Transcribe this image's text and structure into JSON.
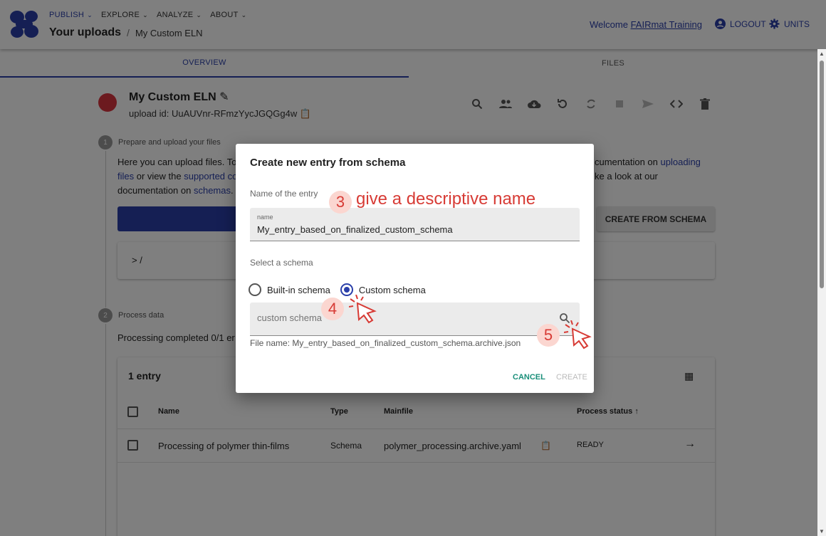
{
  "header": {
    "menus": [
      "PUBLISH",
      "EXPLORE",
      "ANALYZE",
      "ABOUT"
    ],
    "breadcrumb_root": "Your uploads",
    "breadcrumb_sep": "/",
    "breadcrumb_current": "My Custom ELN",
    "welcome_prefix": "Welcome ",
    "welcome_user": "FAIRmat Training",
    "logout": "LOGOUT",
    "units": "UNITS"
  },
  "tabs": {
    "overview": "OVERVIEW",
    "files": "FILES"
  },
  "upload": {
    "title": "My Custom ELN",
    "id_label": "upload id: UuAUVnr-RFmzYycJGQGg4w"
  },
  "step1": {
    "num": "1",
    "title": "Prepare and upload your files",
    "text_a": "Here you can upload files. Top",
    "text_b": "cumentation on ",
    "link_uploading": "uploading",
    "link_files": "files",
    "text_c": " or view the ",
    "link_supported": "supported co",
    "text_d": "ke a look at our",
    "text_e": "documentation on ",
    "link_schemas": "schemas",
    "text_f": ".",
    "create_from_schema": "CREATE FROM SCHEMA",
    "path": "> /"
  },
  "step2": {
    "num": "2",
    "title": "Process data",
    "processing": "Processing completed  0/1 er"
  },
  "table": {
    "title": "1 entry",
    "columns": [
      "Name",
      "Type",
      "Mainfile",
      "Process status ↑"
    ],
    "rows": [
      {
        "name": "Processing of polymer thin-films",
        "type": "Schema",
        "mainfile": "polymer_processing.archive.yaml",
        "status": "READY"
      }
    ]
  },
  "dialog": {
    "title": "Create new entry from schema",
    "name_section": "Name of the entry",
    "name_label": "name",
    "name_value": "My_entry_based_on_finalized_custom_schema",
    "schema_section": "Select a schema",
    "builtin": "Built-in schema",
    "custom": "Custom schema",
    "schema_placeholder": "custom schema",
    "file_name": "File name: My_entry_based_on_finalized_custom_schema.archive.json",
    "cancel": "CANCEL",
    "create": "CREATE"
  },
  "annotations": {
    "step3_num": "3",
    "step3_text": "give a descriptive name",
    "step4_num": "4",
    "step5_num": "5"
  },
  "colors": {
    "primary": "#2a3fa9",
    "annotation": "#d73b35",
    "cancel": "#1a8f7a",
    "avatar": "#d9343e"
  }
}
